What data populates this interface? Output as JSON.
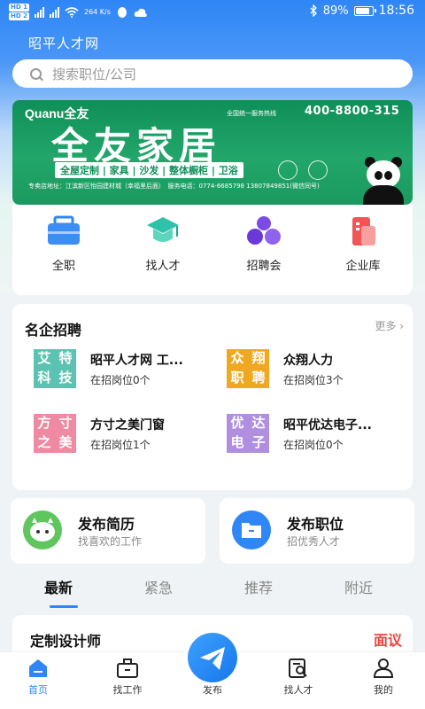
{
  "status_bar": {
    "network_speed": "264 K/s",
    "battery": "89%",
    "time": "18:56"
  },
  "app_title": "昭平人才网",
  "search": {
    "placeholder": "搜索职位/公司"
  },
  "banner": {
    "brand": "Quanu全友",
    "hotline_label": "全国统一服务热线",
    "hotline": "400-8800-315",
    "headline": "全友家居",
    "tags": "全屋定制 | 家具 | 沙发 | 整体橱柜 | 卫浴",
    "address": "专卖店地址：江滨新区怡园建材城（幸福里后面）　服务电话：0774-6685798 13807849851(微信同号)"
  },
  "categories": [
    {
      "label": "全职",
      "icon": "briefcase-icon"
    },
    {
      "label": "找人才",
      "icon": "graduation-cap-icon"
    },
    {
      "label": "招聘会",
      "icon": "people-group-icon"
    },
    {
      "label": "企业库",
      "icon": "building-icon"
    }
  ],
  "featured": {
    "title": "名企招聘",
    "more": "更多",
    "companies": [
      {
        "logo": [
          "艾",
          "特",
          "科",
          "技"
        ],
        "logo_color": "#5cc3b2",
        "name": "昭平人才网 工...",
        "count": "在招岗位0个"
      },
      {
        "logo": [
          "众",
          "翔",
          "职",
          "聘"
        ],
        "logo_color": "#f0a820",
        "name": "众翔人力",
        "count": "在招岗位3个"
      },
      {
        "logo": [
          "方",
          "寸",
          "之",
          "美"
        ],
        "logo_color": "#ee8aa2",
        "name": "方寸之美门窗",
        "count": "在招岗位1个"
      },
      {
        "logo": [
          "优",
          "达",
          "电",
          "子"
        ],
        "logo_color": "#b08ee0",
        "name": "昭平优达电子...",
        "count": "在招岗位0个"
      }
    ]
  },
  "actions": [
    {
      "title": "发布简历",
      "subtitle": "找喜欢的工作",
      "icon": "robot-icon",
      "color": "#5ec65c"
    },
    {
      "title": "发布职位",
      "subtitle": "招优秀人才",
      "icon": "folder-icon",
      "color": "#2f86f6"
    }
  ],
  "tabs": [
    "最新",
    "紧急",
    "推荐",
    "附近"
  ],
  "job": {
    "title": "定制设计师",
    "pay": "面议"
  },
  "nav": [
    "首页",
    "找工作",
    "发布",
    "找人才",
    "我的"
  ],
  "colors": {
    "primary": "#2f86f6",
    "accent_red": "#e8463d"
  }
}
